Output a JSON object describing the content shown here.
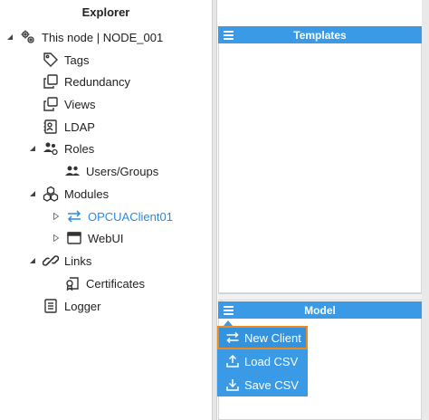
{
  "explorer": {
    "title": "Explorer",
    "items": [
      {
        "label": "This node | NODE_001"
      },
      {
        "label": "Tags"
      },
      {
        "label": "Redundancy"
      },
      {
        "label": "Views"
      },
      {
        "label": "LDAP"
      },
      {
        "label": "Roles"
      },
      {
        "label": "Users/Groups"
      },
      {
        "label": "Modules"
      },
      {
        "label": "OPCUAClient01"
      },
      {
        "label": "WebUI"
      },
      {
        "label": "Links"
      },
      {
        "label": "Certificates"
      },
      {
        "label": "Logger"
      }
    ]
  },
  "templates_panel": {
    "title": "Templates"
  },
  "model_panel": {
    "title": "Model"
  },
  "menu": {
    "items": [
      {
        "label": "New Client",
        "icon": "swap-arrows-icon"
      },
      {
        "label": "Load CSV",
        "icon": "upload-icon"
      },
      {
        "label": "Save CSV",
        "icon": "download-icon"
      }
    ]
  },
  "colors": {
    "accent": "#3a9ae5",
    "highlight": "#f08a1c",
    "link": "#2a8be0"
  }
}
